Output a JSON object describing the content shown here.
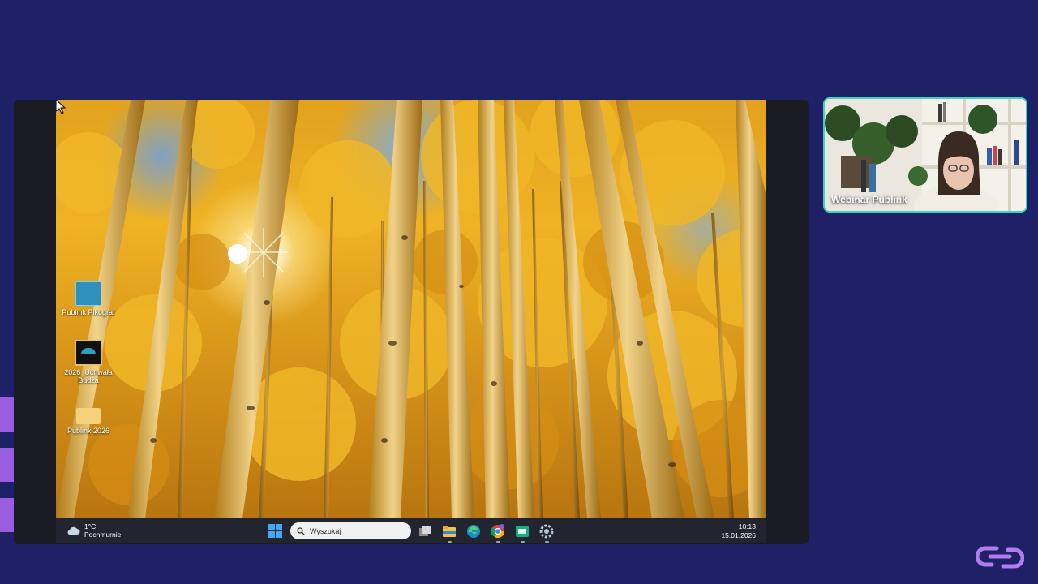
{
  "desktop": {
    "icons": [
      {
        "label": "Publink Pikograf",
        "icon": "publink-shortcut-icon"
      },
      {
        "label": "2026_Uchwała Budża",
        "icon": "document-thumbnail-icon"
      },
      {
        "label": "Publink 2026",
        "icon": "folder-icon"
      }
    ]
  },
  "taskbar": {
    "weather": {
      "temperature": "1°C",
      "condition": "Pochmurnie",
      "icon": "cloud-icon"
    },
    "search_placeholder": "Wyszukaj",
    "apps": [
      "task-view-icon",
      "file-explorer-icon",
      "edge-icon",
      "chrome-icon",
      "app-green-icon",
      "settings-icon"
    ],
    "time": "10:13",
    "date": "15.01.2026"
  },
  "video": {
    "participant_name": "Webinar Publink"
  },
  "colors": {
    "background": "#1f2167",
    "accent": "#9b5de0",
    "video_border": "#3fd4c2"
  }
}
